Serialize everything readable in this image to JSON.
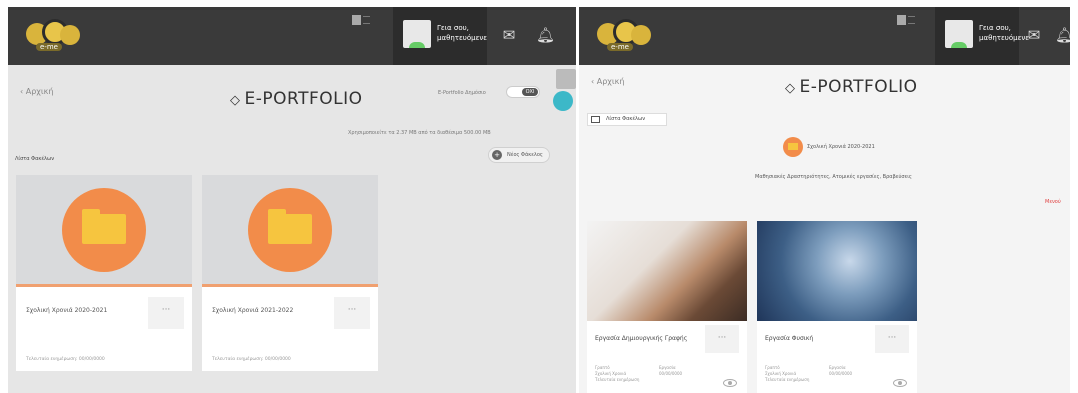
{
  "left": {
    "user_name": "Γεια σου, μαθητευόμενε",
    "logo_text": "e-me",
    "back": "Αρχική",
    "title": "E-PORTFOLIO",
    "public_label": "E-Portfolio Δημόσιο",
    "toggle_text": "ΟΧΙ",
    "storage_text": "Χρησιμοποιείτε τα 2.37 MB από τα διαθέσιμα 500.00 MB",
    "section_label": "Λίστα Φακέλων",
    "new_folder_label": "Νέος Φάκελος",
    "cards": [
      {
        "title": "Σχολική Χρονιά 2020-2021",
        "dots": "···",
        "date": "Τελευταία ενημέρωση: 00/00/0000"
      },
      {
        "title": "Σχολική Χρονιά 2021-2022",
        "dots": "···",
        "date": "Τελευταία ενημέρωση: 00/00/0000"
      }
    ]
  },
  "right": {
    "user_name": "Γεια σου, μαθητευόμενε",
    "logo_text": "e-me",
    "back": "Αρχική",
    "title": "E-PORTFOLIO",
    "folder_list_label": "Λίστα Φακέλων",
    "folder_name": "Σχολική Χρονιά 2020-2021",
    "categories": "Μαθησιακές Δραστηριότητες, Ατομικές εργασίες, Βραβεύσεις",
    "more": "Μενού",
    "cards": [
      {
        "title": "Εργασία Δημιουργικής Γραφής",
        "dots": "···",
        "meta_labels": [
          "Γραπτό",
          "Σχολική Χρονιά",
          "Τελευταία ενημέρωση"
        ],
        "meta_values": [
          "Εργασία",
          "",
          "00/00/0000"
        ]
      },
      {
        "title": "Εργασία Φυσική",
        "dots": "···",
        "meta_labels": [
          "Γραπτό",
          "Σχολική Χρονιά",
          "Τελευταία ενημέρωση"
        ],
        "meta_values": [
          "Εργασία",
          "",
          "00/00/0000"
        ]
      }
    ]
  },
  "colors": {
    "topbar": "#3a3a3a",
    "accent_orange": "#f28c4a",
    "folder_yellow": "#f6c53f",
    "teal": "#3cb8c8"
  }
}
